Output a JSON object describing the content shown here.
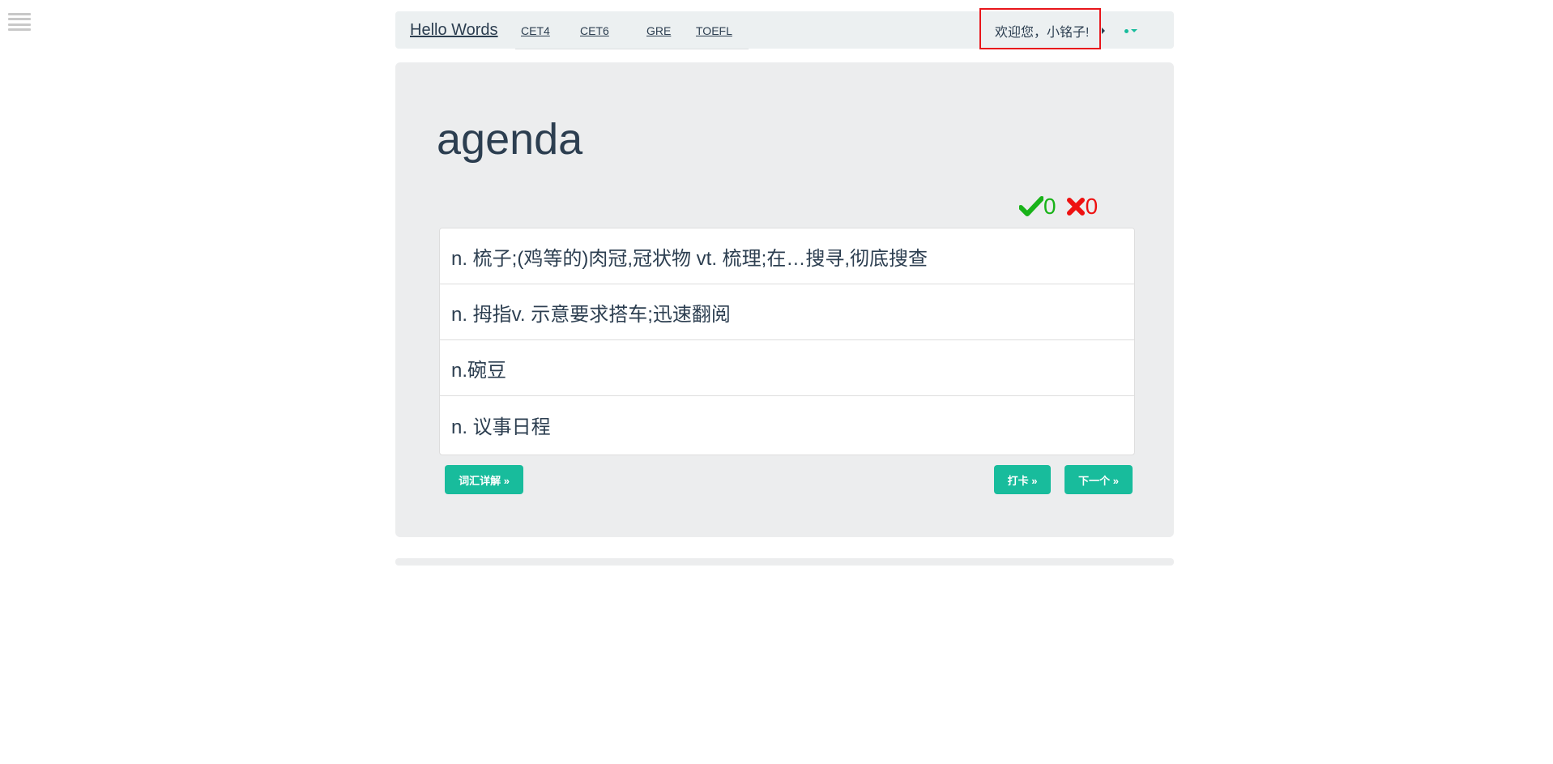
{
  "nav": {
    "brand": "Hello Words",
    "links": [
      "CET4",
      "CET6",
      "GRE",
      "TOEFL"
    ],
    "welcome": "欢迎您，小铭子!"
  },
  "quiz": {
    "word": "agenda",
    "correct_count": "0",
    "wrong_count": "0",
    "options": [
      "n. 梳子;(鸡等的)肉冠,冠状物 vt. 梳理;在…搜寻,彻底搜查",
      "n. 拇指v. 示意要求搭车;迅速翻阅",
      "n.碗豆",
      "n. 议事日程"
    ],
    "buttons": {
      "detail": "词汇详解 »",
      "checkin": "打卡 »",
      "next": "下一个 »"
    }
  },
  "colors": {
    "accent": "#18bc9c",
    "text": "#2c3e50",
    "correct": "#19b319",
    "wrong": "#ee1111",
    "highlight_border": "#e8161b"
  },
  "icons": [
    "menu-icon",
    "user-icon",
    "caret-down-icon",
    "check-icon",
    "cross-icon"
  ]
}
